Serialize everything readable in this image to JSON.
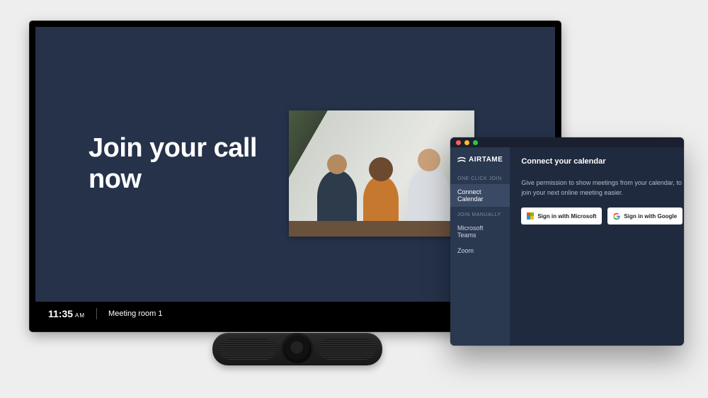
{
  "tv": {
    "headline": "Join your call now",
    "time": "11:35",
    "ampm": "AM",
    "room": "Meeting room 1"
  },
  "app": {
    "brand": "AIRTAME",
    "sidebar": {
      "section_one_click": "ONE CLICK JOIN",
      "connect_calendar": "Connect Calendar",
      "section_join_manually": "JOIN MANUALLY",
      "ms_teams": "Microsoft Teams",
      "zoom": "Zoom"
    },
    "main": {
      "title": "Connect your calendar",
      "hint": "Give permission to show meetings from your calendar, to join your next online meeting easier.",
      "signin_ms": "Sign in with Microsoft",
      "signin_google": "Sign in with Google"
    }
  }
}
